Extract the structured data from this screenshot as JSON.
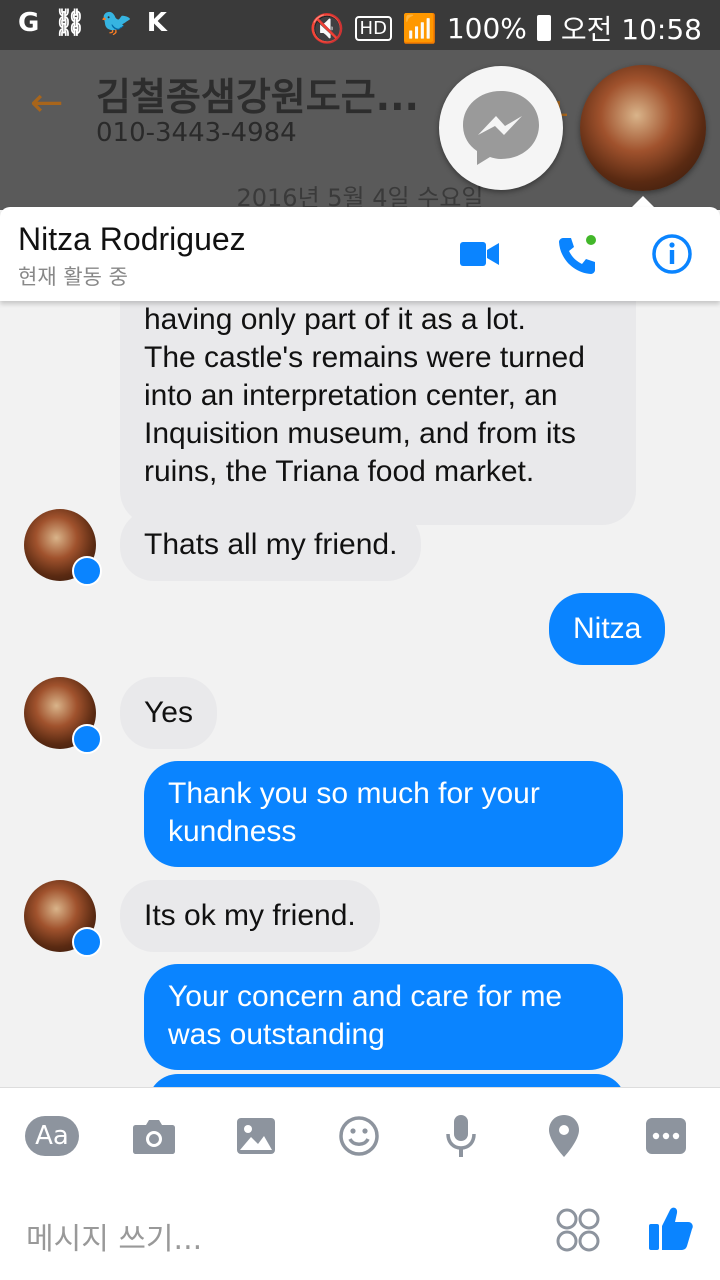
{
  "status_bar": {
    "battery": "100%",
    "time": "오전 10:58",
    "hd": "HD"
  },
  "background_app": {
    "title": "김철종샘강원도근...",
    "phone": "010-3443-4984",
    "date": "2016년 5월 4일 수요일"
  },
  "chat": {
    "contact_name": "Nitza Rodriguez",
    "status": "현재 활동 중"
  },
  "messages": [
    {
      "side": "in",
      "text": "having only part of it as a lot.\nThe castle's remains were turned\ninto an interpretation center, an\nInquisition museum, and from its\nruins, the Triana food market."
    },
    {
      "side": "in",
      "text": "Thats all my friend."
    },
    {
      "side": "out",
      "text": "Nitza"
    },
    {
      "side": "in",
      "text": "Yes"
    },
    {
      "side": "out",
      "text": "Thank you so much for your\nkundness"
    },
    {
      "side": "in",
      "text": "Its ok my friend."
    },
    {
      "side": "out",
      "text": "Your concern and care for me\nwas outstanding"
    }
  ],
  "composer": {
    "placeholder": "메시지 쓰기...",
    "aa_label": "Aa"
  },
  "colors": {
    "accent": "#0a84ff",
    "incoming_bubble": "#e9e9eb"
  }
}
